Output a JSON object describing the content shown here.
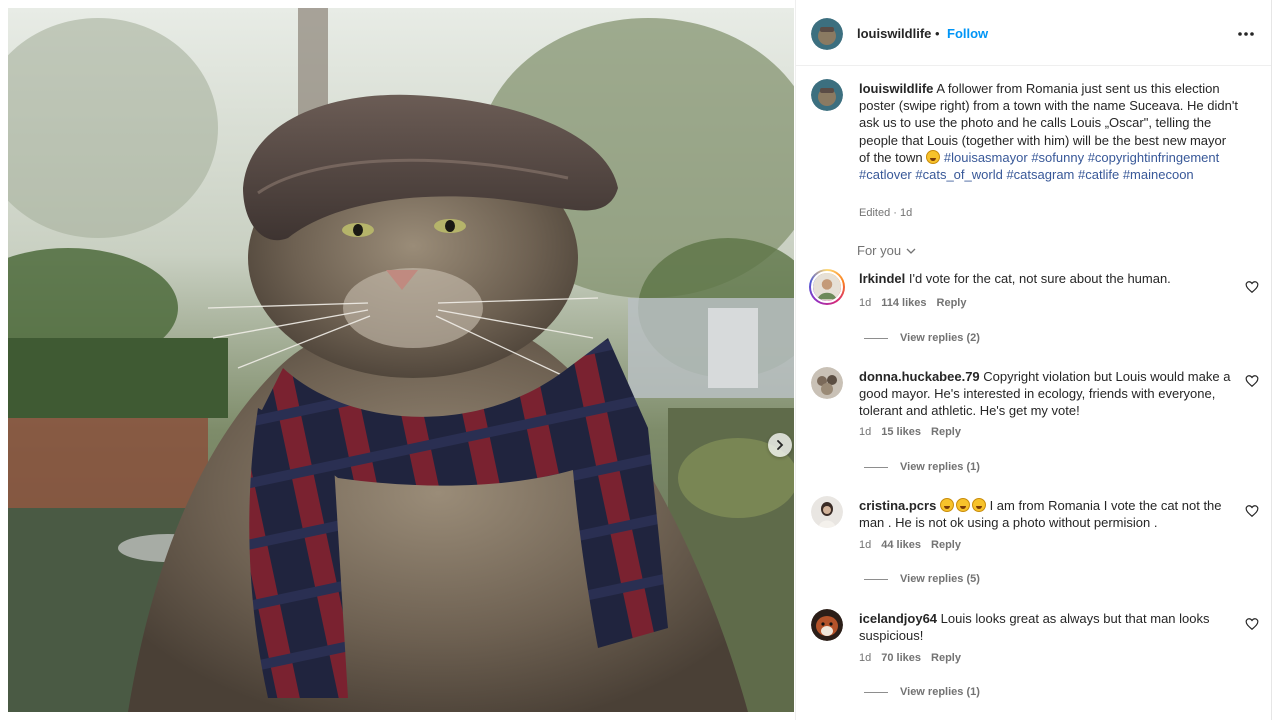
{
  "post": {
    "username": "louiswildlife",
    "follow_label": "Follow",
    "separator": "•",
    "caption_parts": {
      "text1": "A follower from Romania just sent us this election poster (swipe right) from a town with the name Suceava. He didn't ask us to use the photo and he calls Louis „Oscar\", telling the people that Louis (together with him) will be the best new mayor of the town",
      "hashtags": [
        "#louisasmayor",
        "#sofunny",
        "#copyrightinfringement",
        "#catlover",
        "#cats_of_world",
        "#catsagram",
        "#catlife",
        "#mainecoon"
      ]
    },
    "edited_label": "Edited · 1d",
    "media_alt": "Maine coon cat wearing a tweed flat cap and a navy and red striped scarf, sitting outdoors in a garden"
  },
  "comments_filter": "For you",
  "comments": [
    {
      "username": "lrkindel",
      "text": "I'd vote for the cat, not sure about the human.",
      "age": "1d",
      "likes": "114 likes",
      "reply": "Reply",
      "view_replies": "View replies (2)"
    },
    {
      "username": "donna.huckabee.79",
      "text": "Copyright violation but Louis would make a good mayor. He's interested in ecology, friends with everyone, tolerant and athletic. He's get my vote!",
      "age": "1d",
      "likes": "15 likes",
      "reply": "Reply",
      "view_replies": "View replies (1)"
    },
    {
      "username": "cristina.pcrs",
      "text": "I am from Romania I vote the cat not the man . He is not ok using a photo without permision .",
      "age": "1d",
      "likes": "44 likes",
      "reply": "Reply",
      "view_replies": "View replies (5)"
    },
    {
      "username": "icelandjoy64",
      "text": "Louis looks great as always but that man looks suspicious!",
      "age": "1d",
      "likes": "70 likes",
      "reply": "Reply",
      "view_replies": "View replies (1)"
    }
  ],
  "colors": {
    "link": "#0095f6",
    "hashtag": "#385898",
    "secondary_text": "#737373"
  }
}
